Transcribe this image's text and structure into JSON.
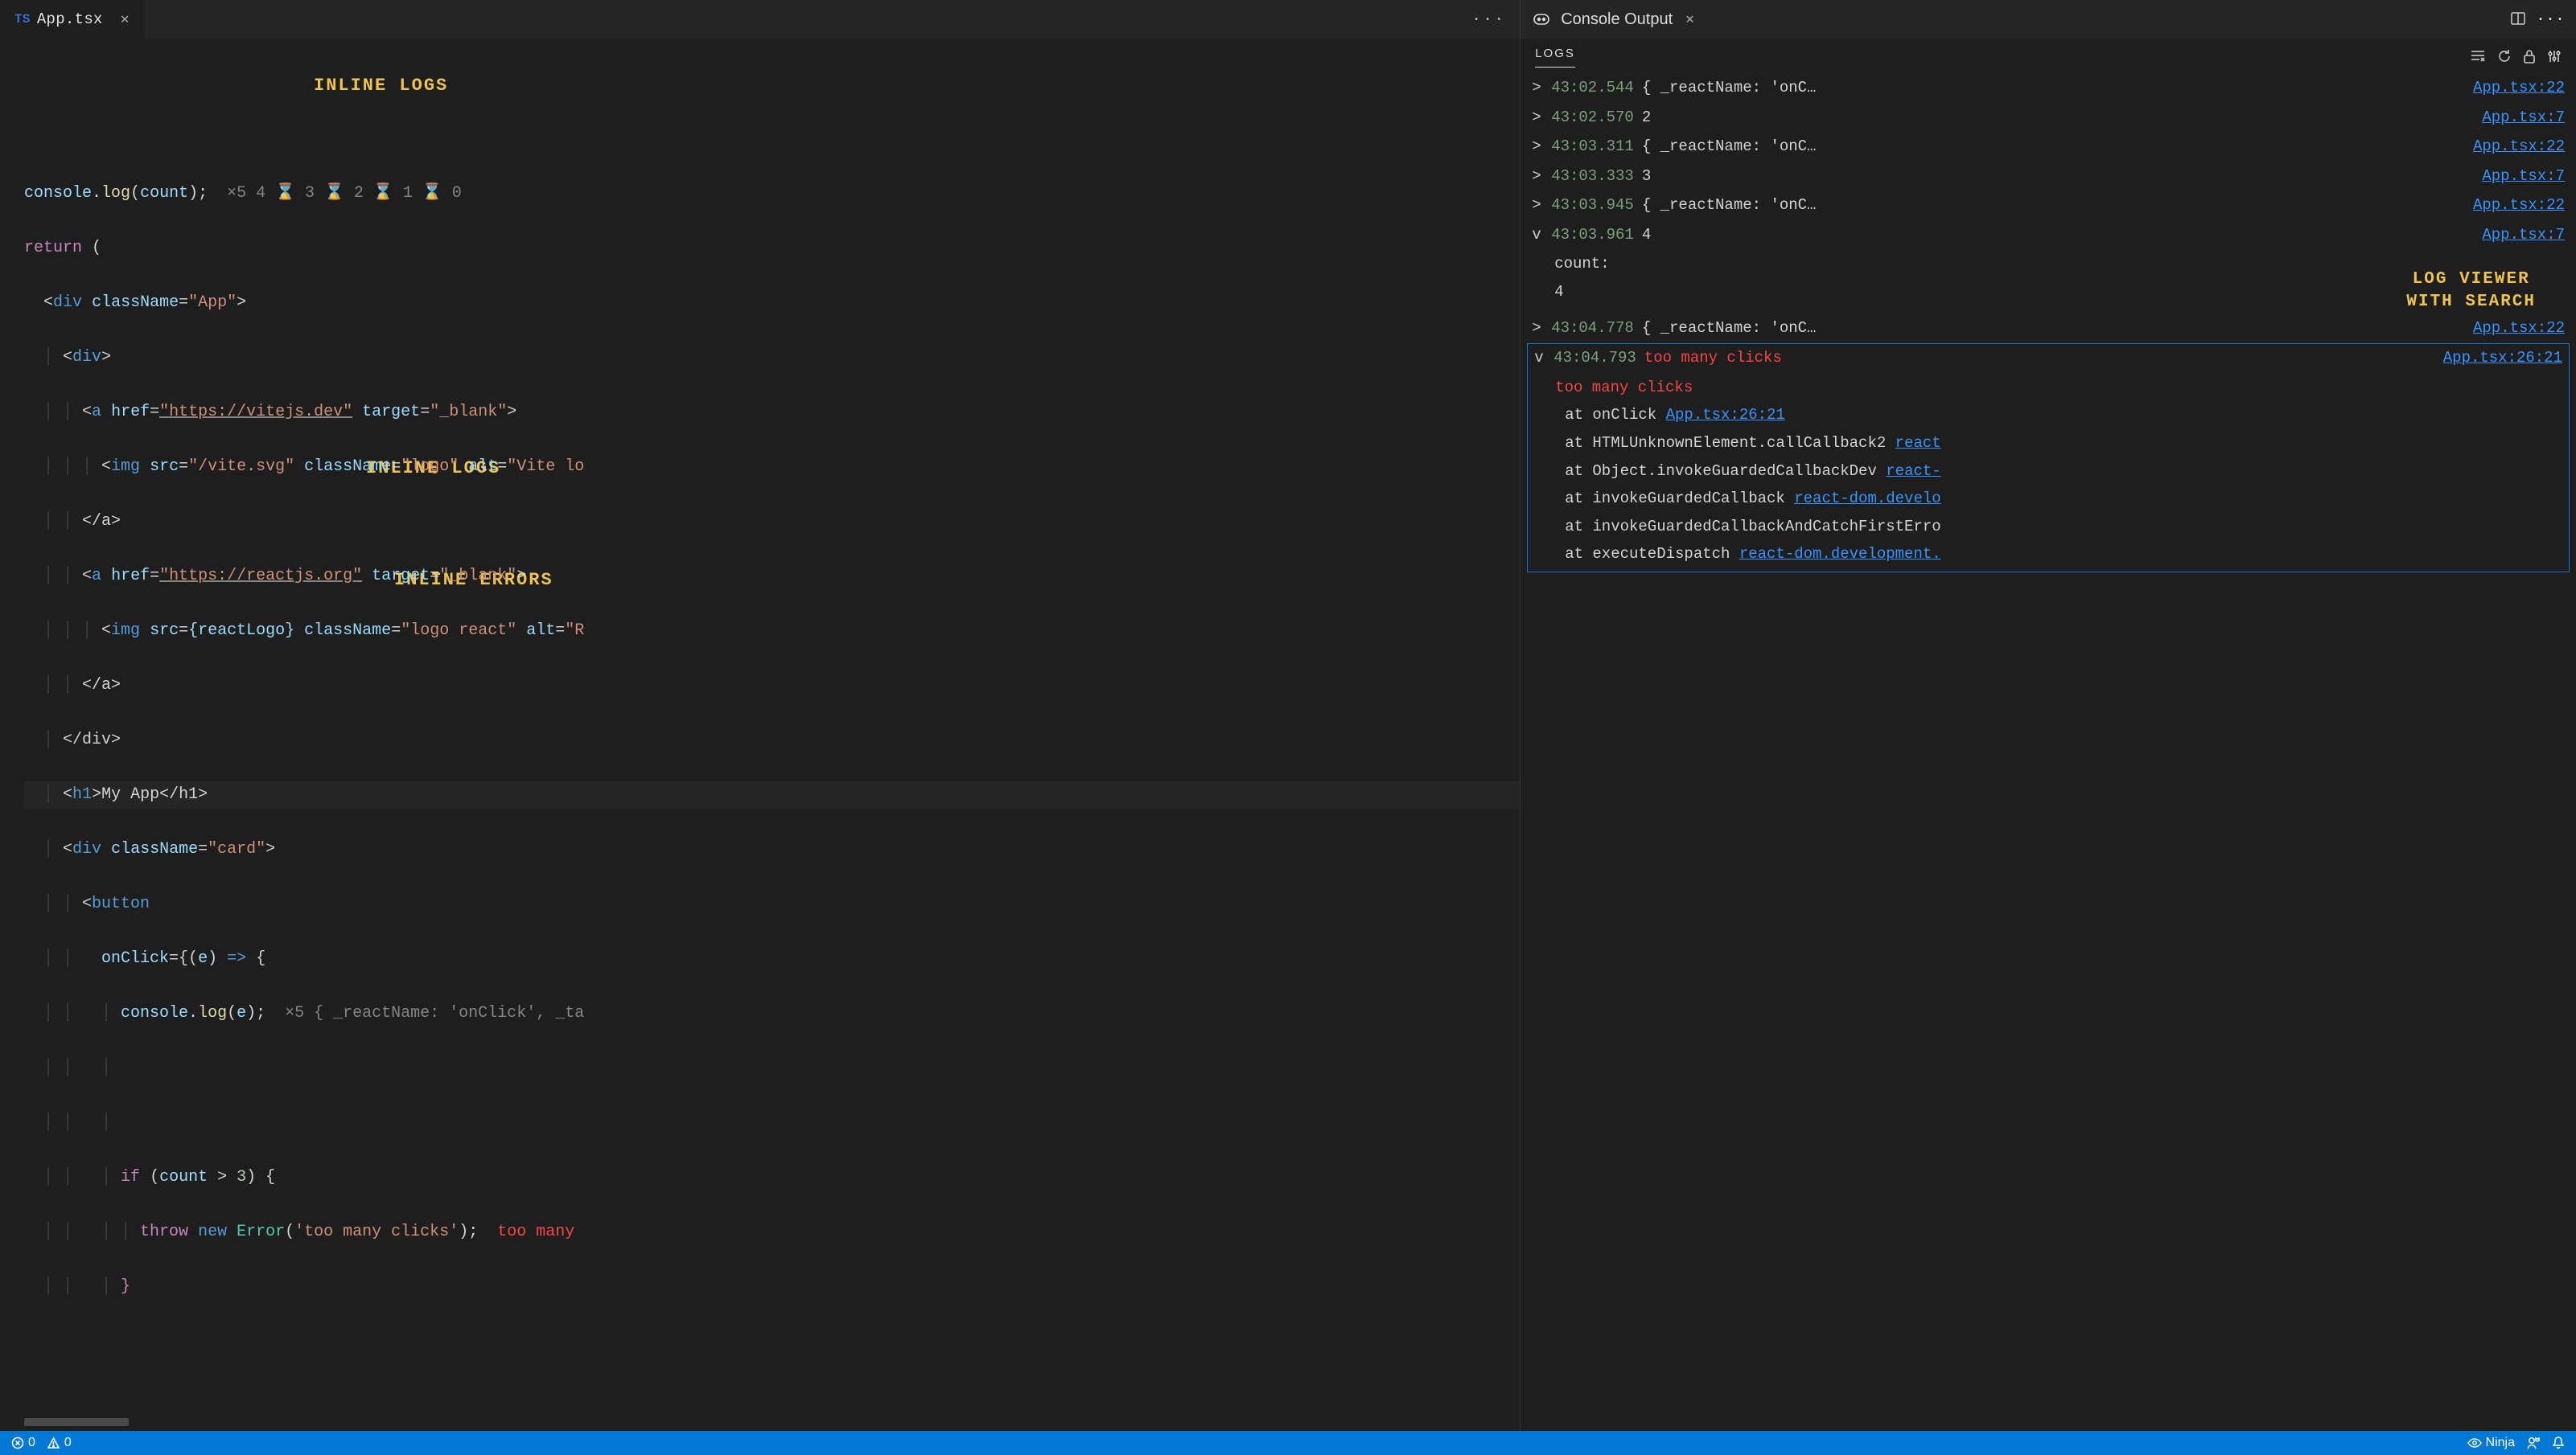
{
  "editor": {
    "tab": {
      "ts_badge": "TS",
      "filename": "App.tsx"
    },
    "annotations": {
      "inline_logs_1": "INLINE LOGS",
      "inline_logs_2": "INLINE LOGS",
      "inline_errors": "INLINE ERRORS"
    },
    "code": {
      "l1_a": "console",
      "l1_b": "log",
      "l1_c": "count",
      "l1_hint": "×5 4 ⌛ 3 ⌛ 2 ⌛ 1 ⌛ 0",
      "l2": "return",
      "l3_tag": "div",
      "l3_attr": "className",
      "l3_val": "\"App\"",
      "l4_tag": "div",
      "l5_tag": "a",
      "l5_href": "href",
      "l5_hrefv": "\"https://vitejs.dev\"",
      "l5_target": "target",
      "l5_targetv": "\"_blank\"",
      "l6_tag": "img",
      "l6_src": "src",
      "l6_srcv": "\"/vite.svg\"",
      "l6_cls": "className",
      "l6_clsv": "\"logo\"",
      "l6_alt": "alt",
      "l6_altv": "\"Vite lo",
      "l7_close": "</a>",
      "l8_tag": "a",
      "l8_hrefv": "\"https://reactjs.org\"",
      "l8_targetv": "\"_blank\"",
      "l9_tag": "img",
      "l9_srcv": "{reactLogo}",
      "l9_clsv": "\"logo react\"",
      "l9_altv": "\"R",
      "l10_close": "</a>",
      "l11_close": "</div>",
      "l12_tag": "h1",
      "l12_text": "My App",
      "l12_close": "</h1>",
      "l13_tag": "div",
      "l13_clsv": "\"card\"",
      "l14_tag": "button",
      "l15_attr": "onClick",
      "l15_param": "e",
      "l16_a": "console",
      "l16_b": "log",
      "l16_c": "e",
      "l16_hint": "×5 { _reactName: 'onClick', _ta",
      "l18_if": "if",
      "l18_cond_a": "count",
      "l18_cond_op": ">",
      "l18_cond_b": "3",
      "l19_throw": "throw",
      "l19_new": "new",
      "l19_err": "Error",
      "l19_msg": "'too many clicks'",
      "l19_hint": "too many",
      "l20_brace": "}"
    }
  },
  "panel": {
    "icon_label": "console-ninja-icon",
    "title": "Console Output",
    "tab": "LOGS",
    "annotations": {
      "viewer": "LOG VIEWER\nWITH SEARCH"
    },
    "logs": [
      {
        "exp": ">",
        "ts": "43:02.544",
        "msg": "{ _reactName: 'onC…",
        "src": "App.tsx:22"
      },
      {
        "exp": ">",
        "ts": "43:02.570",
        "msg": "2",
        "src": "App.tsx:7"
      },
      {
        "exp": ">",
        "ts": "43:03.311",
        "msg": "{ _reactName: 'onC…",
        "src": "App.tsx:22"
      },
      {
        "exp": ">",
        "ts": "43:03.333",
        "msg": "3",
        "src": "App.tsx:7"
      },
      {
        "exp": ">",
        "ts": "43:03.945",
        "msg": "{ _reactName: 'onC…",
        "src": "App.tsx:22"
      },
      {
        "exp": "v",
        "ts": "43:03.961",
        "msg": "4",
        "src": "App.tsx:7"
      }
    ],
    "expanded": {
      "key": "count:",
      "val": "4"
    },
    "log7": {
      "exp": ">",
      "ts": "43:04.778",
      "msg": "{ _reactName: 'onC…",
      "src": "App.tsx:22"
    },
    "error": {
      "exp": "v",
      "ts": "43:04.793",
      "msg": "too many clicks",
      "src": "App.tsx:26:21",
      "detail": "too many clicks",
      "stack": [
        {
          "at": "at onClick ",
          "link": "App.tsx:26:21"
        },
        {
          "at": "at HTMLUnknownElement.callCallback2 ",
          "link": "react"
        },
        {
          "at": "at Object.invokeGuardedCallbackDev ",
          "link": "react-"
        },
        {
          "at": "at invokeGuardedCallback ",
          "link": "react-dom.develo"
        },
        {
          "at": "at invokeGuardedCallbackAndCatchFirstErro",
          "link": ""
        },
        {
          "at": "at executeDispatch ",
          "link": "react-dom.development."
        }
      ]
    }
  },
  "statusbar": {
    "errors": "0",
    "warnings": "0",
    "ninja": "Ninja"
  }
}
